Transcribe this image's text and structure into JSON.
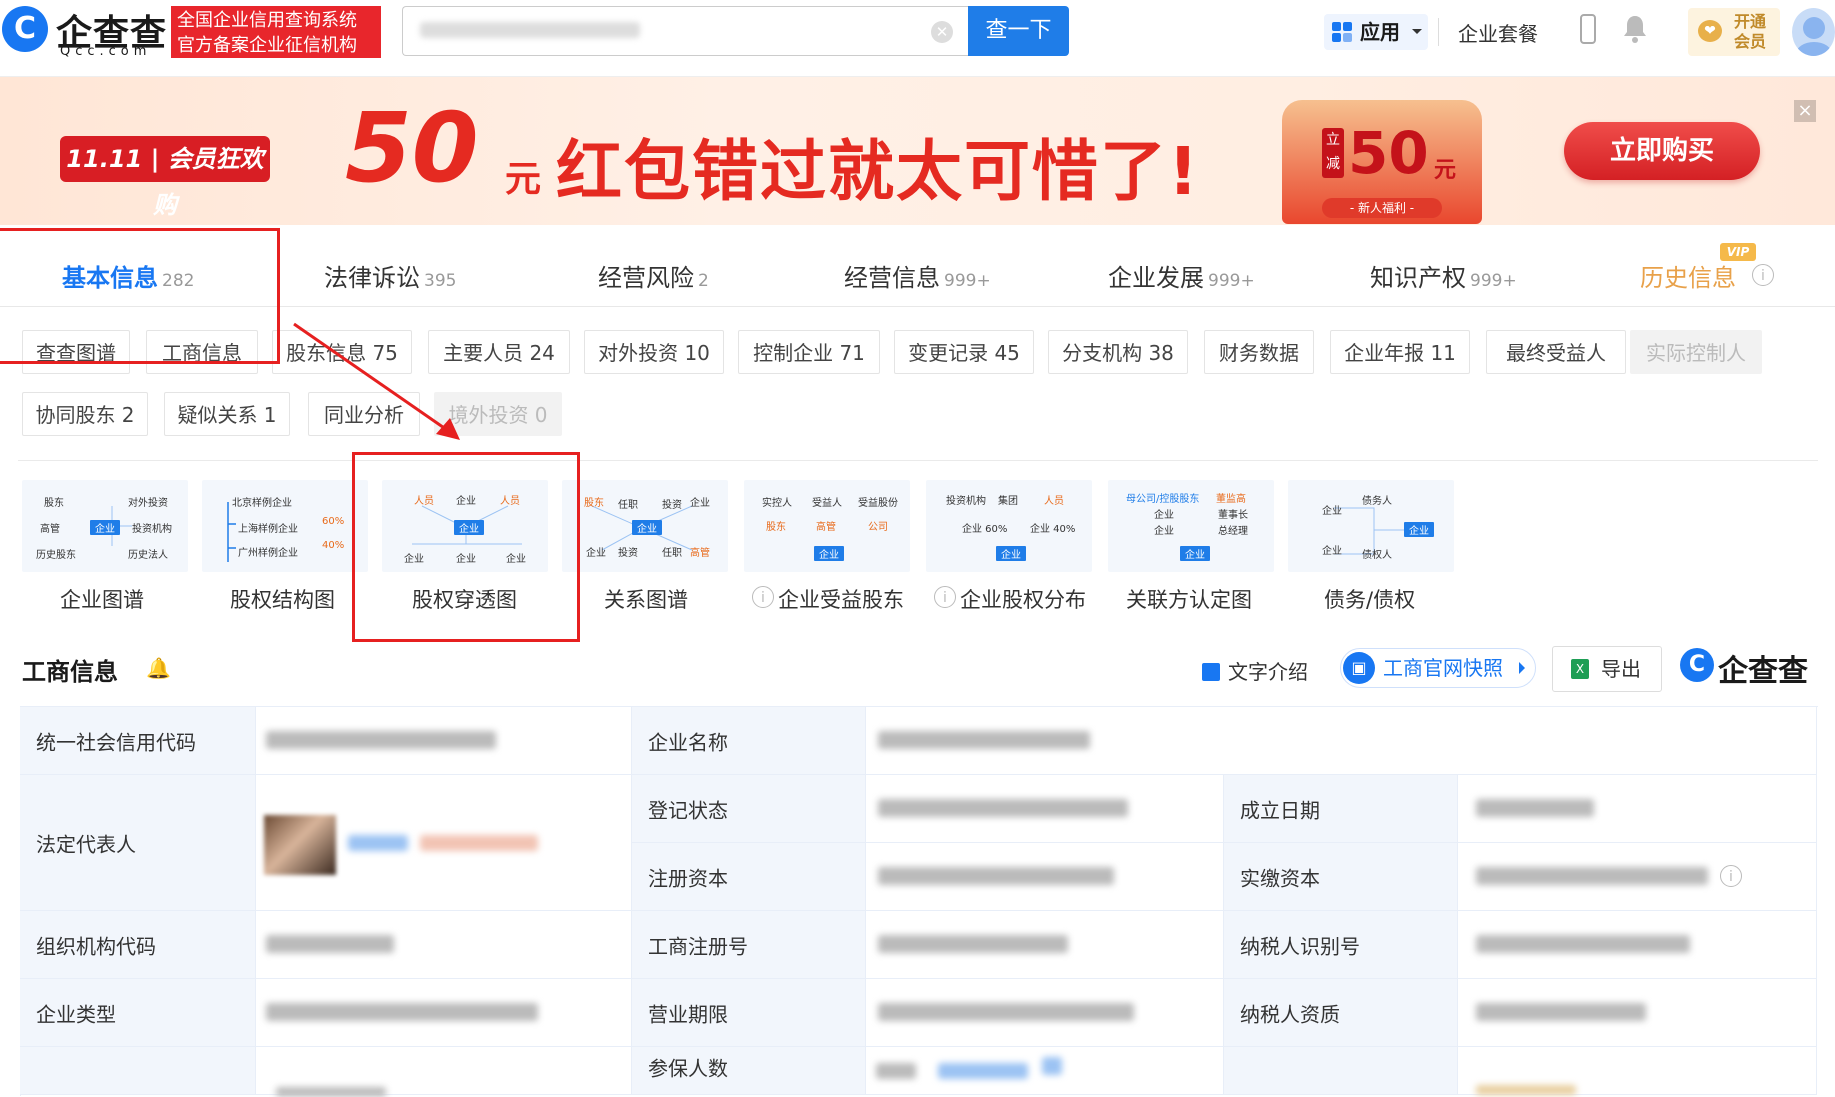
{
  "header": {
    "logo_mark": "C",
    "logo_text": "企查查",
    "logo_sub": "Qcc.com",
    "slogan_line1": "全国企业信用查询系统",
    "slogan_line2": "官方备案企业征信机构",
    "search_button": "查一下",
    "apps_label": "应用",
    "enterprise_package": "企业套餐",
    "vip_line1": "开通",
    "vip_line2": "会员"
  },
  "banner": {
    "badge": "11.11 | 会员狂欢购",
    "big_number": "50",
    "currency": "元",
    "headline": "红包错过就太可惜了!",
    "coupon_tag": "立减",
    "coupon_amount": "50",
    "coupon_currency": "元",
    "coupon_footer": "- 新人福利 -",
    "buy_button": "立即购买",
    "close_label": "×"
  },
  "tabs": [
    {
      "label": "基本信息",
      "count": "282"
    },
    {
      "label": "法律诉讼",
      "count": "395"
    },
    {
      "label": "经营风险",
      "count": "2"
    },
    {
      "label": "经营信息",
      "count": "999+"
    },
    {
      "label": "企业发展",
      "count": "999+"
    },
    {
      "label": "知识产权",
      "count": "999+"
    },
    {
      "label": "历史信息",
      "count": ""
    }
  ],
  "vip_badge": "VIP",
  "chips_row1": [
    "查查图谱",
    "工商信息",
    "股东信息 75",
    "主要人员 24",
    "对外投资 10",
    "控制企业 71",
    "变更记录 45",
    "分支机构 38",
    "财务数据",
    "企业年报 11",
    "最终受益人",
    "实际控制人"
  ],
  "chips_row2": [
    "协同股东 2",
    "疑似关系 1",
    "同业分析",
    "境外投资 0"
  ],
  "diagrams": [
    {
      "label": "企业图谱",
      "mini": [
        "股东",
        "对外投资",
        "高管",
        "企业",
        "投资机构",
        "历史股东",
        "历史法人"
      ]
    },
    {
      "label": "股权结构图",
      "mini": [
        "北京样例企业",
        "上海样例企业",
        "60%",
        "广州样例企业",
        "40%"
      ]
    },
    {
      "label": "股权穿透图",
      "mini": [
        "人员",
        "企业",
        "人员",
        "企业",
        "企业",
        "企业",
        "企业"
      ]
    },
    {
      "label": "关系图谱",
      "mini": [
        "股东",
        "任职",
        "投资",
        "企业",
        "企业",
        "企业",
        "投资",
        "任职",
        "高管"
      ]
    },
    {
      "label": "企业受益股东",
      "mini": [
        "实控人",
        "受益人",
        "受益股份",
        "股东",
        "高管",
        "公司",
        "企业"
      ]
    },
    {
      "label": "企业股权分布",
      "mini": [
        "投资机构",
        "集团",
        "人员",
        "企业 60%",
        "企业 40%",
        "企业"
      ]
    },
    {
      "label": "关联方认定图",
      "mini": [
        "母公司/控股股东",
        "董监高",
        "企业",
        "董事长",
        "企业",
        "总经理",
        "企业"
      ]
    },
    {
      "label": "债务/债权",
      "mini": [
        "企业",
        "债务人",
        "企业",
        "企业",
        "债权人"
      ]
    }
  ],
  "section": {
    "title": "工商信息",
    "text_intro": "文字介绍",
    "snapshot": "工商官网快照",
    "export": "导出",
    "brand": "企查查"
  },
  "table": {
    "labels": [
      "统一社会信用代码",
      "企业名称",
      "法定代表人",
      "登记状态",
      "成立日期",
      "注册资本",
      "实缴资本",
      "组织机构代码",
      "工商注册号",
      "纳税人识别号",
      "企业类型",
      "营业期限",
      "纳税人资质",
      "参保人数"
    ]
  },
  "colors": {
    "brand_blue": "#1877f2",
    "accent_red": "#e52a21",
    "annotation_red": "#e62020",
    "vip_gold": "#e8a14a"
  }
}
